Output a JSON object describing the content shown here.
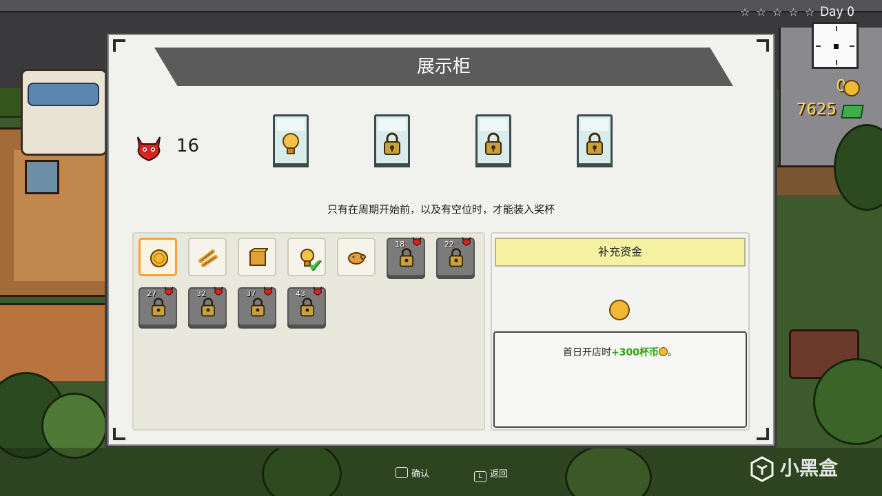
{
  "hud": {
    "stars": "☆ ☆ ☆ ☆ ☆",
    "day": "Day 0",
    "coins": "0",
    "cash": "7625"
  },
  "panel": {
    "title": "展示柜",
    "trophy_count": "16",
    "notice": "只有在周期开始前，以及有空位时，才能装入奖杯",
    "display_slots": [
      {
        "content": "lightbulb-trophy-icon"
      },
      {
        "content": "lock-icon"
      },
      {
        "content": "lock-icon"
      },
      {
        "content": "lock-icon"
      }
    ],
    "inventory": [
      {
        "icon": "coin-trophy-icon",
        "state": "selected"
      },
      {
        "icon": "bones-trophy-icon",
        "state": "unlocked"
      },
      {
        "icon": "wood-block-trophy-icon",
        "state": "unlocked"
      },
      {
        "icon": "lightbulb-trophy-icon",
        "state": "equipped"
      },
      {
        "icon": "piggy-bank-trophy-icon",
        "state": "unlocked"
      },
      {
        "icon": "lock-icon",
        "state": "locked",
        "requirement": "18"
      },
      {
        "icon": "lock-icon",
        "state": "locked",
        "requirement": "22"
      },
      {
        "icon": "lock-icon",
        "state": "locked",
        "requirement": "27"
      },
      {
        "icon": "lock-icon",
        "state": "locked",
        "requirement": "32"
      },
      {
        "icon": "lock-icon",
        "state": "locked",
        "requirement": "37"
      },
      {
        "icon": "lock-icon",
        "state": "locked",
        "requirement": "43"
      }
    ],
    "info": {
      "title": "补充资金",
      "desc_prefix": "首日开店时",
      "desc_highlight": "+300杯币",
      "desc_suffix": "。"
    }
  },
  "prompts": {
    "confirm_key": "",
    "confirm_label": "确认",
    "back_key": "L",
    "back_label": "返回"
  },
  "watermark": "小黑盒",
  "colors": {
    "accent_orange": "#f2a43a",
    "highlight_green": "#2f9c21",
    "info_title_bg": "#f4f1a0",
    "banner": "#5b5b5b"
  }
}
